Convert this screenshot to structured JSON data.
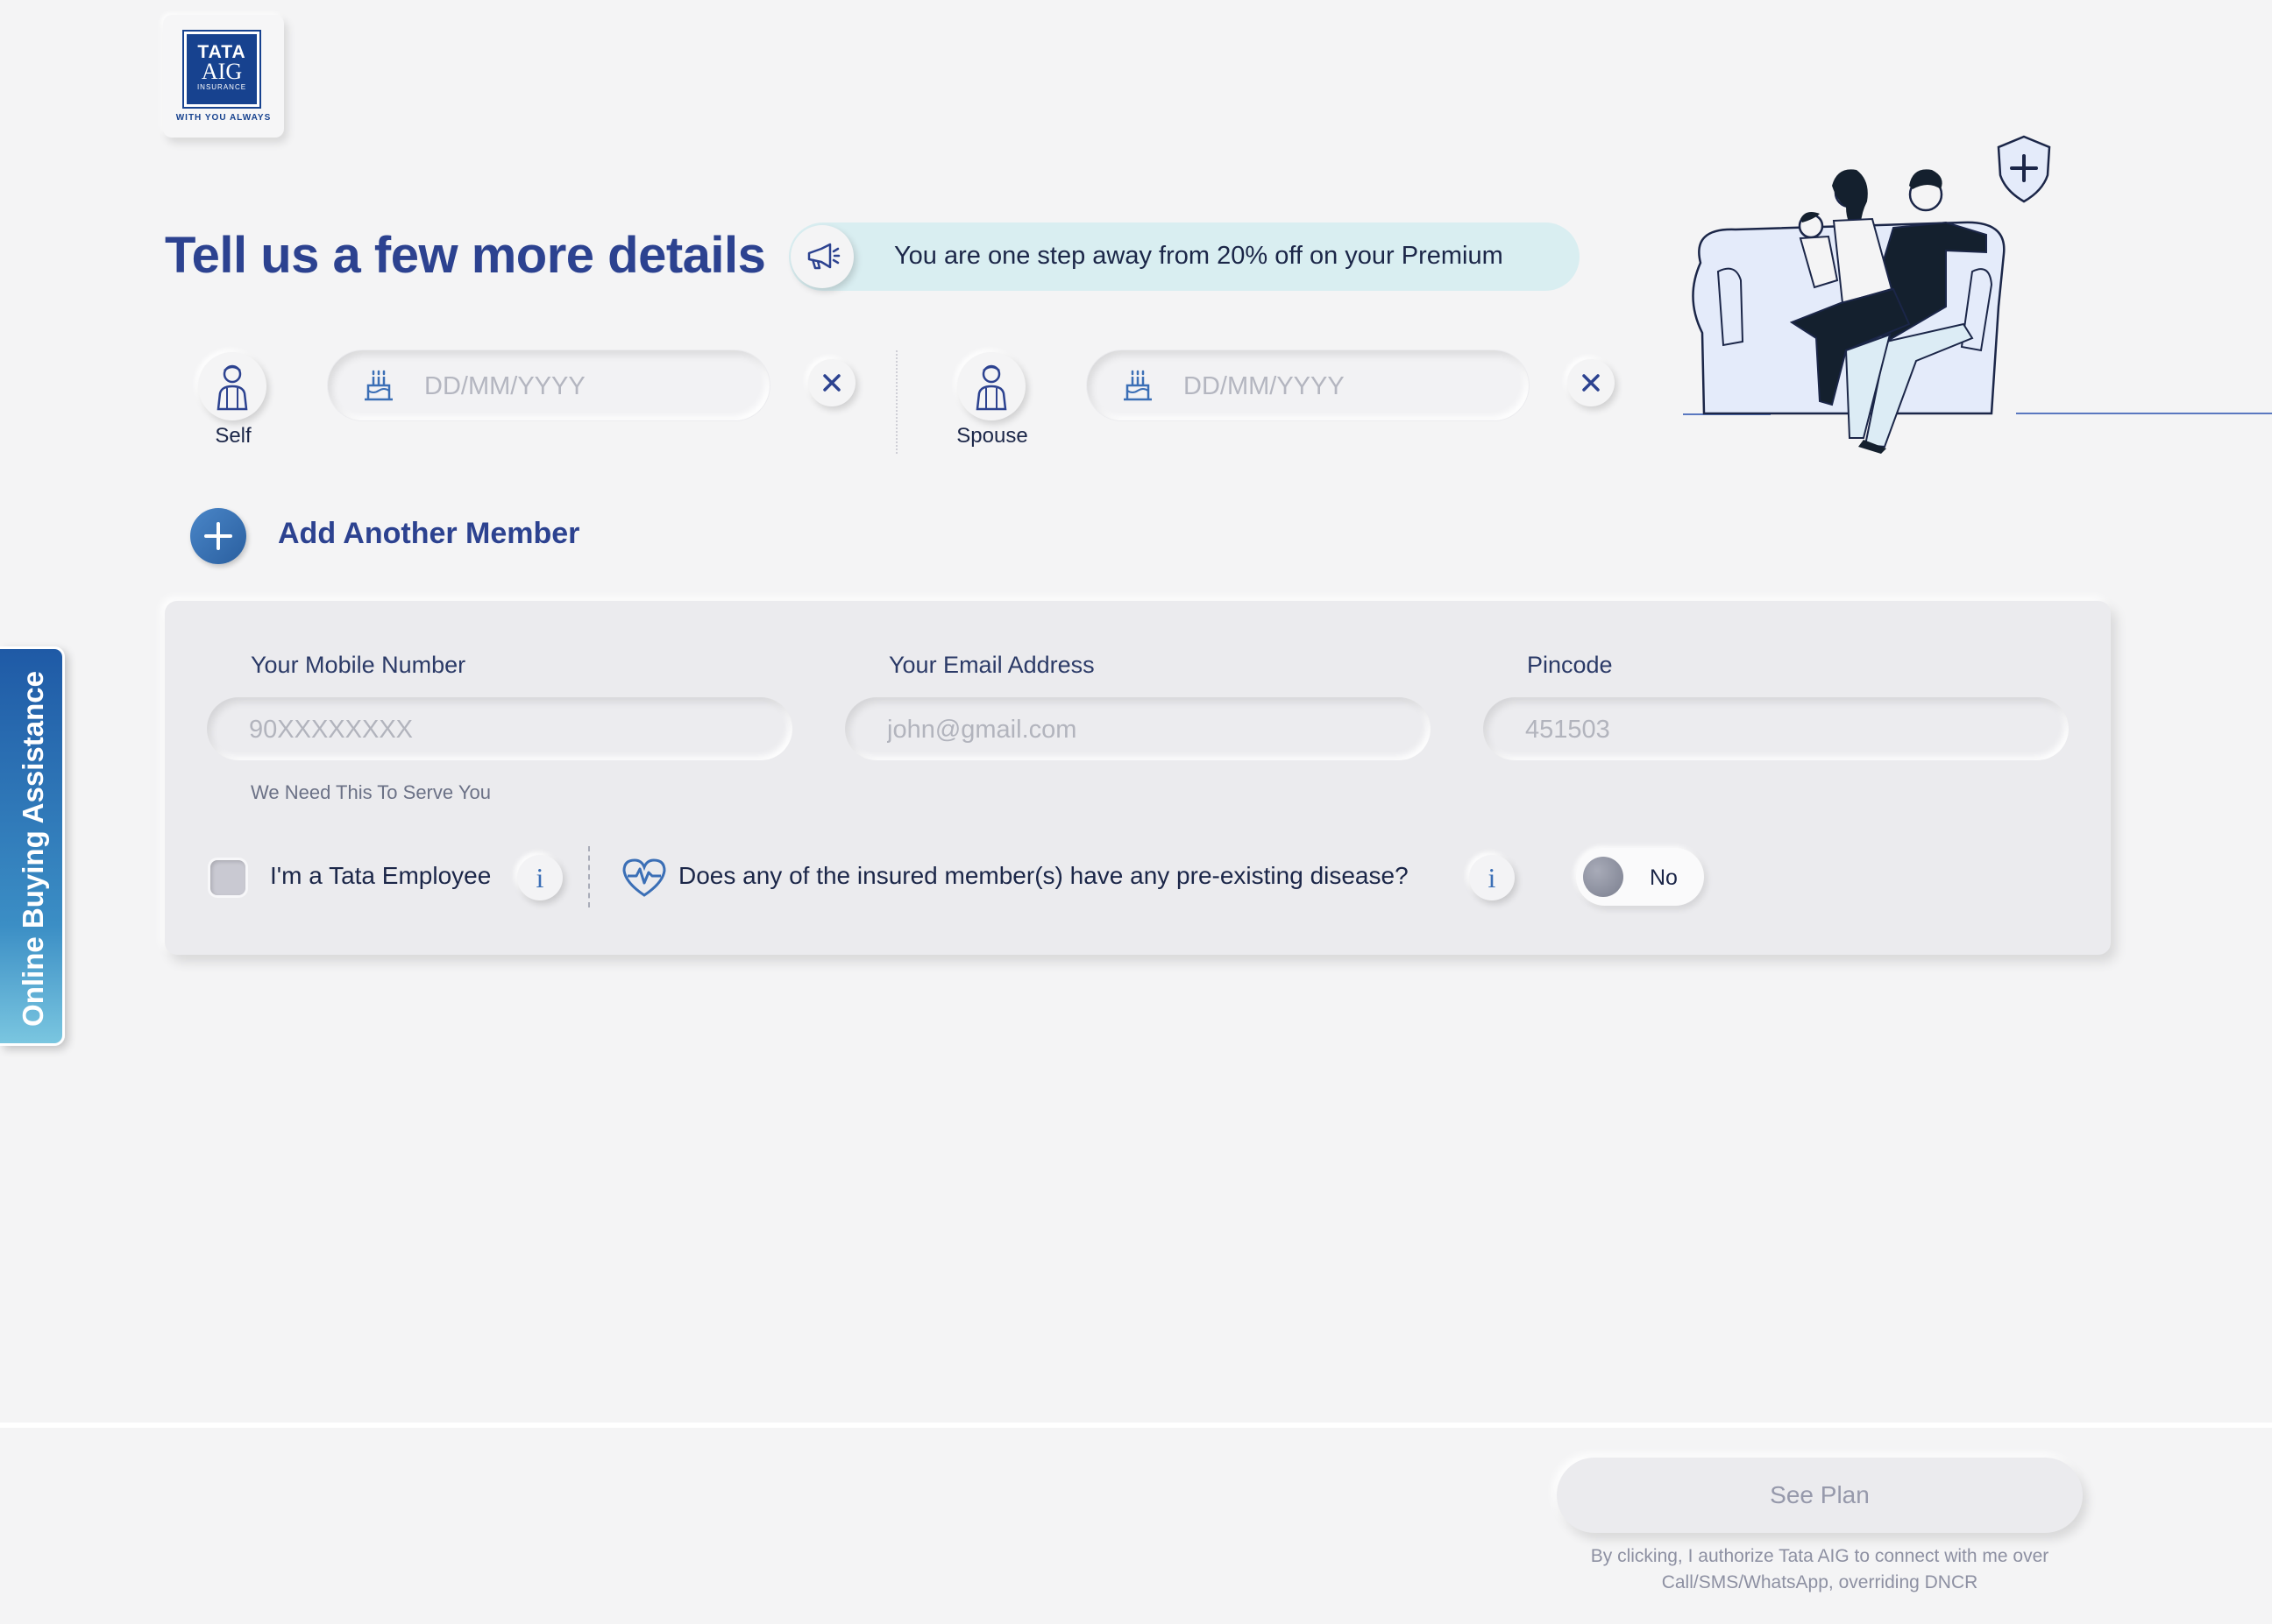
{
  "brand": {
    "logo_line1": "TATA",
    "logo_line2": "AIG",
    "logo_line3": "INSURANCE",
    "tagline": "WITH YOU ALWAYS"
  },
  "heading": "Tell us a few more details",
  "promo": {
    "icon": "megaphone-icon",
    "text": "You are one step away from 20% off on your Premium"
  },
  "members": [
    {
      "label": "Self",
      "dob_placeholder": "DD/MM/YYYY",
      "icon": "person-icon"
    },
    {
      "label": "Spouse",
      "dob_placeholder": "DD/MM/YYYY",
      "icon": "person-icon"
    }
  ],
  "add_member_label": "Add Another Member",
  "contact": {
    "mobile_label": "Your Mobile Number",
    "mobile_placeholder": "90XXXXXXXX",
    "mobile_helper": "We Need This To Serve You",
    "email_label": "Your Email Address",
    "email_placeholder": "john@gmail.com",
    "pincode_label": "Pincode",
    "pincode_placeholder": "451503"
  },
  "tata_employee_label": "I'm a Tata Employee",
  "disease_question": "Does any of the insured member(s) have any pre-existing disease?",
  "disease_toggle_value": "No",
  "side_tab_label": "Online Buying Assistance",
  "see_plan_label": "See Plan",
  "disclaimer_line1": "By clicking, I authorize Tata AIG to connect with me over",
  "disclaimer_line2": "Call/SMS/WhatsApp, overriding DNCR",
  "colors": {
    "primary": "#2c4290",
    "accent": "#3b6fb6",
    "promo_bg": "#d9eef1",
    "background": "#f4f4f5"
  }
}
